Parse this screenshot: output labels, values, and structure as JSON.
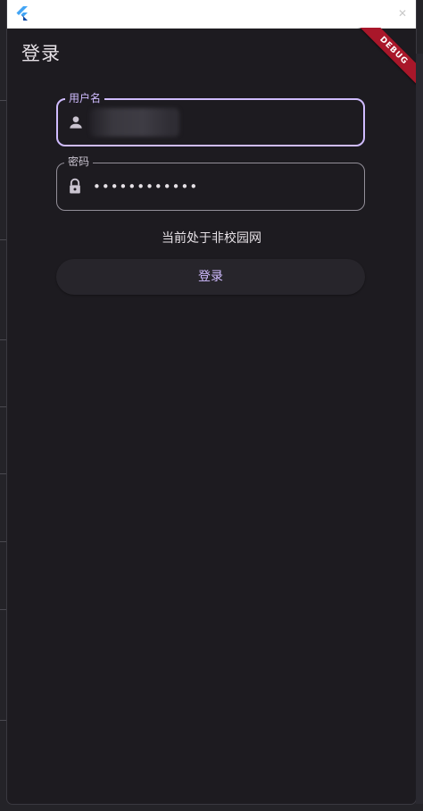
{
  "window": {
    "close_glyph": "✕",
    "debug_banner": "DEBUG"
  },
  "appbar": {
    "title": "登录"
  },
  "form": {
    "username": {
      "label": "用户名",
      "icon": "person-icon"
    },
    "password": {
      "label": "密码",
      "value": "••••••••••••",
      "icon": "lock-icon"
    },
    "network_status": "当前处于非校园网",
    "login_button": "登录"
  },
  "colors": {
    "accent": "#d0bcff",
    "surface": "#1d1b20",
    "debug_ribbon": "#a9172a"
  }
}
